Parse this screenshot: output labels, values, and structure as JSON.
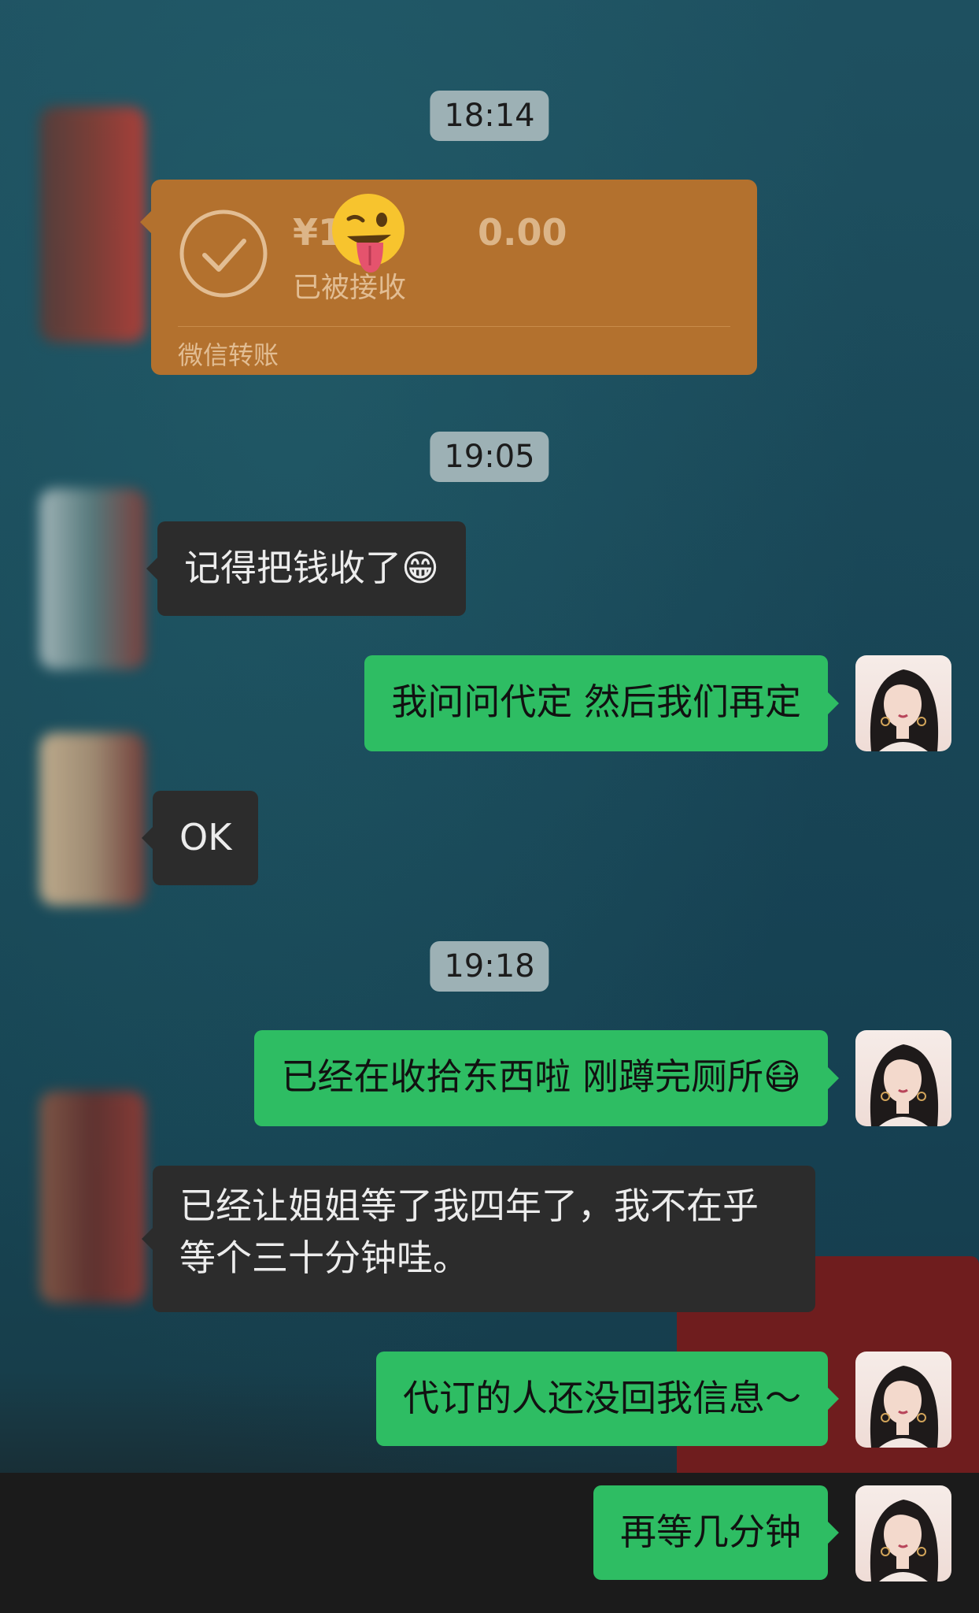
{
  "transfer": {
    "amount": "¥1",
    "amount_tail": "0.00",
    "status": "已被接收",
    "label": "微信转账",
    "sticker_icon": "winking-tongue-emoji"
  },
  "messages": [
    {
      "type": "time",
      "text": "18:14"
    },
    {
      "type": "time",
      "text": "19:05"
    },
    {
      "type": "in",
      "text": "记得把钱收了",
      "emoji": "😁"
    },
    {
      "type": "out",
      "text": "我问问代定 然后我们再定"
    },
    {
      "type": "in",
      "text": "OK"
    },
    {
      "type": "time",
      "text": "19:18"
    },
    {
      "type": "out",
      "text": "已经在收拾东西啦 刚蹲完厕所",
      "emoji": "😷"
    },
    {
      "type": "in",
      "text": "已经让姐姐等了我四年了，我不在乎等个三十分钟哇。"
    },
    {
      "type": "out",
      "text": "代订的人还没回我信息～"
    },
    {
      "type": "out",
      "text": "再等几分钟"
    }
  ],
  "colors": {
    "outgoing_bubble": "#2ebd63",
    "incoming_bubble": "#2c2c2c",
    "transfer_card": "#b3712e",
    "time_badge": "#9db1b5"
  }
}
